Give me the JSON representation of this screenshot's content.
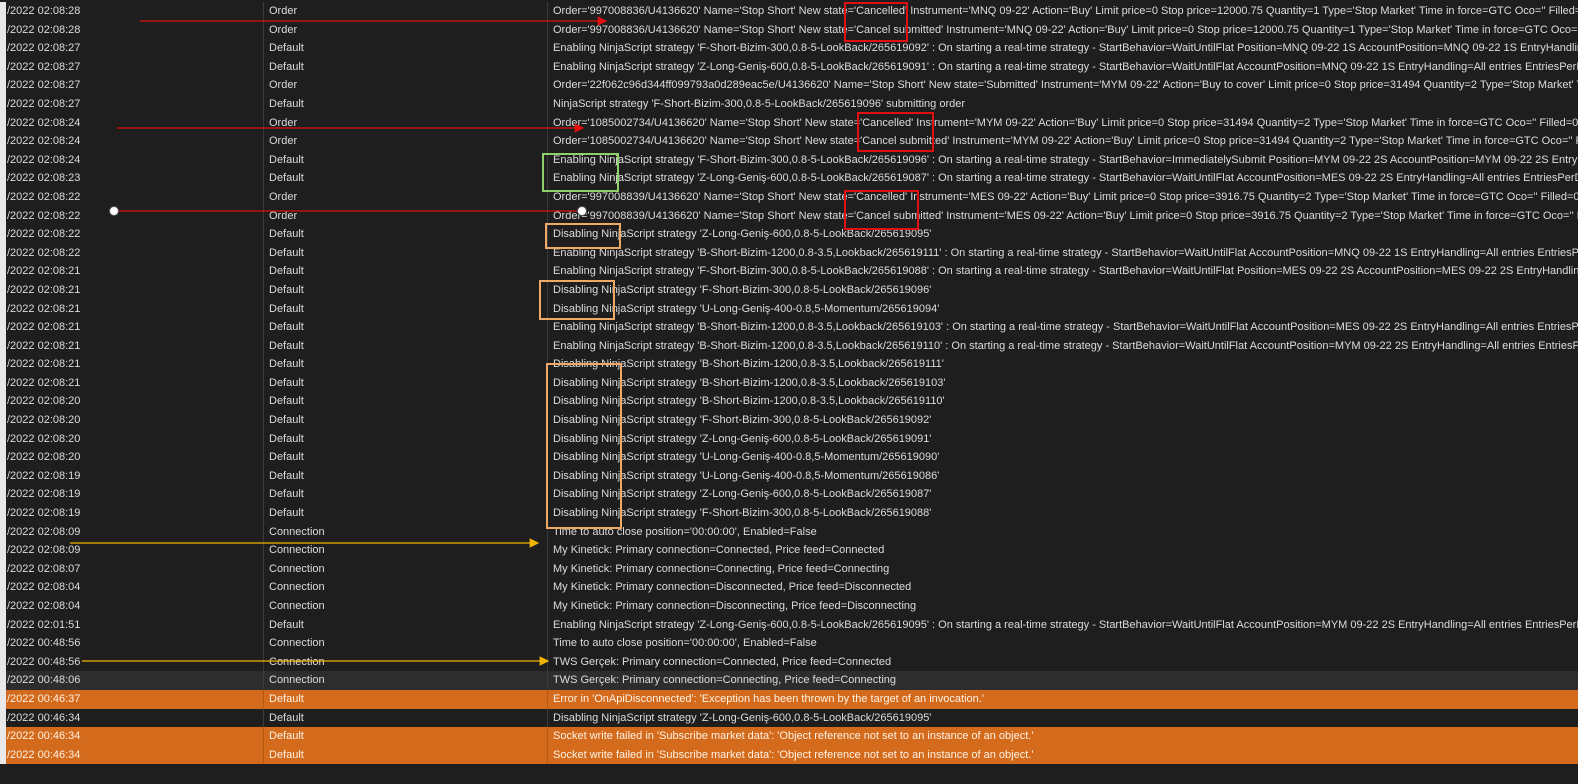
{
  "colors": {
    "background": "#1e1e1e",
    "text": "#dcdcdc",
    "error_row": "#d46a1c",
    "annotation_red": "#e01010",
    "annotation_green": "#8fcf6a",
    "annotation_orange": "#f0a868",
    "annotation_yellow": "#f0b400"
  },
  "log_rows": [
    {
      "time": "/2022 02:08:28",
      "category": "Order",
      "message": "Order='997008836/U4136620' Name='Stop Short' New state='Cancelled' Instrument='MNQ 09-22' Action='Buy' Limit price=0 Stop price=12000.75 Quantity=1 Type='Stop Market' Time in force=GTC Oco='' Filled=0 Fill",
      "style": "normal"
    },
    {
      "time": "/2022 02:08:28",
      "category": "Order",
      "message": "Order='997008836/U4136620' Name='Stop Short' New state='Cancel submitted' Instrument='MNQ 09-22' Action='Buy' Limit price=0 Stop price=12000.75 Quantity=1 Type='Stop Market' Time in force=GTC Oco='' Filled=0",
      "style": "normal"
    },
    {
      "time": "/2022 02:08:27",
      "category": "Default",
      "message": "Enabling NinjaScript strategy 'F-Short-Bizim-300,0.8-5-LookBack/265619092' : On starting a real-time strategy - StartBehavior=WaitUntilFlat Position=MNQ 09-22 1S AccountPosition=MNQ 09-22 1S EntryHandling=",
      "style": "normal"
    },
    {
      "time": "/2022 02:08:27",
      "category": "Default",
      "message": "Enabling NinjaScript strategy 'Z-Long-Geniş-600,0.8-5-LookBack/265619091' : On starting a real-time strategy - StartBehavior=WaitUntilFlat AccountPosition=MNQ 09-22 1S EntryHandling=All entries EntriesPerD",
      "style": "normal"
    },
    {
      "time": "/2022 02:08:27",
      "category": "Order",
      "message": "Order='22f062c96d344ff099793a0d289eac5e/U4136620' Name='Stop Short' New state='Submitted' Instrument='MYM 09-22' Action='Buy to cover' Limit price=0 Stop price=31494 Quantity=2 Type='Stop Market' Ti",
      "style": "normal"
    },
    {
      "time": "/2022 02:08:27",
      "category": "Default",
      "message": "NinjaScript strategy 'F-Short-Bizim-300,0.8-5-LookBack/265619096' submitting order",
      "style": "normal"
    },
    {
      "time": "/2022 02:08:24",
      "category": "Order",
      "message": "Order='1085002734/U4136620' Name='Stop Short' New state='Cancelled' Instrument='MYM 09-22' Action='Buy' Limit price=0 Stop price=31494 Quantity=2 Type='Stop Market' Time in force=GTC Oco='' Filled=0 Fi",
      "style": "normal"
    },
    {
      "time": "/2022 02:08:24",
      "category": "Order",
      "message": "Order='1085002734/U4136620' Name='Stop Short' New state='Cancel submitted' Instrument='MYM 09-22' Action='Buy' Limit price=0 Stop price=31494 Quantity=2 Type='Stop Market' Time in force=GTC Oco='' Fill",
      "style": "normal"
    },
    {
      "time": "/2022 02:08:24",
      "category": "Default",
      "message": "Enabling NinjaScript strategy 'F-Short-Bizim-300,0.8-5-LookBack/265619096' : On starting a real-time strategy - StartBehavior=ImmediatelySubmit Position=MYM 09-22 2S AccountPosition=MYM 09-22 2S EntryH",
      "style": "normal"
    },
    {
      "time": "/2022 02:08:23",
      "category": "Default",
      "message": "Enabling NinjaScript strategy 'Z-Long-Geniş-600,0.8-5-LookBack/265619087' : On starting a real-time strategy - StartBehavior=WaitUntilFlat AccountPosition=MES 09-22 2S EntryHandling=All entries EntriesPerD",
      "style": "normal"
    },
    {
      "time": "/2022 02:08:22",
      "category": "Order",
      "message": "Order='997008839/U4136620' Name='Stop Short' New state='Cancelled' Instrument='MES 09-22' Action='Buy' Limit price=0 Stop price=3916.75 Quantity=2 Type='Stop Market' Time in force=GTC Oco='' Filled=0 F",
      "style": "normal"
    },
    {
      "time": "/2022 02:08:22",
      "category": "Order",
      "message": "Order='997008839/U4136620' Name='Stop Short' New state='Cancel submitted' Instrument='MES 09-22' Action='Buy' Limit price=0 Stop price=3916.75 Quantity=2 Type='Stop Market' Time in force=GTC Oco='' Fi",
      "style": "normal"
    },
    {
      "time": "/2022 02:08:22",
      "category": "Default",
      "message": "Disabling NinjaScript strategy 'Z-Long-Geniş-600,0.8-5-LookBack/265619095'",
      "style": "normal"
    },
    {
      "time": "/2022 02:08:22",
      "category": "Default",
      "message": "Enabling NinjaScript strategy 'B-Short-Bizim-1200,0.8-3.5,Lookback/265619111' : On starting a real-time strategy - StartBehavior=WaitUntilFlat AccountPosition=MNQ 09-22 1S EntryHandling=All entries EntriesPers",
      "style": "normal"
    },
    {
      "time": "/2022 02:08:21",
      "category": "Default",
      "message": "Enabling NinjaScript strategy 'F-Short-Bizim-300,0.8-5-LookBack/265619088' : On starting a real-time strategy - StartBehavior=WaitUntilFlat Position=MES 09-22 2S AccountPosition=MES 09-22 2S EntryHandling",
      "style": "normal"
    },
    {
      "time": "/2022 02:08:21",
      "category": "Default",
      "message": "Disabling NinjaScript strategy 'F-Short-Bizim-300,0.8-5-LookBack/265619096'",
      "style": "normal"
    },
    {
      "time": "/2022 02:08:21",
      "category": "Default",
      "message": "Disabling NinjaScript strategy 'U-Long-Geniş-400-0.8,5-Momentum/265619094'",
      "style": "normal"
    },
    {
      "time": "/2022 02:08:21",
      "category": "Default",
      "message": "Enabling NinjaScript strategy 'B-Short-Bizim-1200,0.8-3.5,Lookback/265619103' : On starting a real-time strategy - StartBehavior=WaitUntilFlat AccountPosition=MES 09-22 2S EntryHandling=All entries EntriesPe",
      "style": "normal"
    },
    {
      "time": "/2022 02:08:21",
      "category": "Default",
      "message": "Enabling NinjaScript strategy 'B-Short-Bizim-1200,0.8-3.5,Lookback/265619110' : On starting a real-time strategy - StartBehavior=WaitUntilFlat AccountPosition=MYM 09-22 2S EntryHandling=All entries EntriesPe",
      "style": "normal"
    },
    {
      "time": "/2022 02:08:21",
      "category": "Default",
      "message": "Disabling NinjaScript strategy 'B-Short-Bizim-1200,0.8-3.5,Lookback/265619111'",
      "style": "normal"
    },
    {
      "time": "/2022 02:08:21",
      "category": "Default",
      "message": "Disabling NinjaScript strategy 'B-Short-Bizim-1200,0.8-3.5,Lookback/265619103'",
      "style": "normal"
    },
    {
      "time": "/2022 02:08:20",
      "category": "Default",
      "message": "Disabling NinjaScript strategy 'B-Short-Bizim-1200,0.8-3.5,Lookback/265619110'",
      "style": "normal"
    },
    {
      "time": "/2022 02:08:20",
      "category": "Default",
      "message": "Disabling NinjaScript strategy 'F-Short-Bizim-300,0.8-5-LookBack/265619092'",
      "style": "normal"
    },
    {
      "time": "/2022 02:08:20",
      "category": "Default",
      "message": "Disabling NinjaScript strategy 'Z-Long-Geniş-600,0.8-5-LookBack/265619091'",
      "style": "normal"
    },
    {
      "time": "/2022 02:08:20",
      "category": "Default",
      "message": "Disabling NinjaScript strategy 'U-Long-Geniş-400-0.8,5-Momentum/265619090'",
      "style": "normal"
    },
    {
      "time": "/2022 02:08:19",
      "category": "Default",
      "message": "Disabling NinjaScript strategy 'U-Long-Geniş-400-0.8,5-Momentum/265619086'",
      "style": "normal"
    },
    {
      "time": "/2022 02:08:19",
      "category": "Default",
      "message": "Disabling NinjaScript strategy 'Z-Long-Geniş-600,0.8-5-LookBack/265619087'",
      "style": "normal"
    },
    {
      "time": "/2022 02:08:19",
      "category": "Default",
      "message": "Disabling NinjaScript strategy 'F-Short-Bizim-300,0.8-5-LookBack/265619088'",
      "style": "normal"
    },
    {
      "time": "/2022 02:08:09",
      "category": "Connection",
      "message": "Time to auto close position='00:00:00', Enabled=False",
      "style": "normal"
    },
    {
      "time": "/2022 02:08:09",
      "category": "Connection",
      "message": "My Kinetick: Primary connection=Connected, Price feed=Connected",
      "style": "normal"
    },
    {
      "time": "/2022 02:08:07",
      "category": "Connection",
      "message": "My Kinetick: Primary connection=Connecting, Price feed=Connecting",
      "style": "normal"
    },
    {
      "time": "/2022 02:08:04",
      "category": "Connection",
      "message": "My Kinetick: Primary connection=Disconnected, Price feed=Disconnected",
      "style": "normal"
    },
    {
      "time": "/2022 02:08:04",
      "category": "Connection",
      "message": "My Kinetick: Primary connection=Disconnecting, Price feed=Disconnecting",
      "style": "normal"
    },
    {
      "time": "/2022 02:01:51",
      "category": "Default",
      "message": "Enabling NinjaScript strategy 'Z-Long-Geniş-600,0.8-5-LookBack/265619095' : On starting a real-time strategy - StartBehavior=WaitUntilFlat AccountPosition=MYM 09-22 2S EntryHandling=All entries EntriesPerD",
      "style": "normal"
    },
    {
      "time": "/2022 00:48:56",
      "category": "Connection",
      "message": "Time to auto close position='00:00:00', Enabled=False",
      "style": "normal"
    },
    {
      "time": "/2022 00:48:56",
      "category": "Connection",
      "message": "TWS Gerçek: Primary connection=Connected, Price feed=Connected",
      "style": "normal"
    },
    {
      "time": "/2022 00:48:06",
      "category": "Connection",
      "message": "TWS Gerçek: Primary connection=Connecting, Price feed=Connecting",
      "style": "selected"
    },
    {
      "time": "/2022 00:46:37",
      "category": "Default",
      "message": "Error in 'OnApiDisconnected': 'Exception has been thrown by the target of an invocation.'",
      "style": "error"
    },
    {
      "time": "/2022 00:46:34",
      "category": "Default",
      "message": "Disabling NinjaScript strategy 'Z-Long-Geniş-600,0.8-5-LookBack/265619095'",
      "style": "normal"
    },
    {
      "time": "/2022 00:46:34",
      "category": "Default",
      "message": "Socket write failed in 'Subscribe market data': 'Object reference not set to an instance of an object.'",
      "style": "error"
    },
    {
      "time": "/2022 00:46:34",
      "category": "Default",
      "message": "Socket write failed in 'Subscribe market data': 'Object reference not set to an instance of an object.'",
      "style": "error"
    }
  ]
}
